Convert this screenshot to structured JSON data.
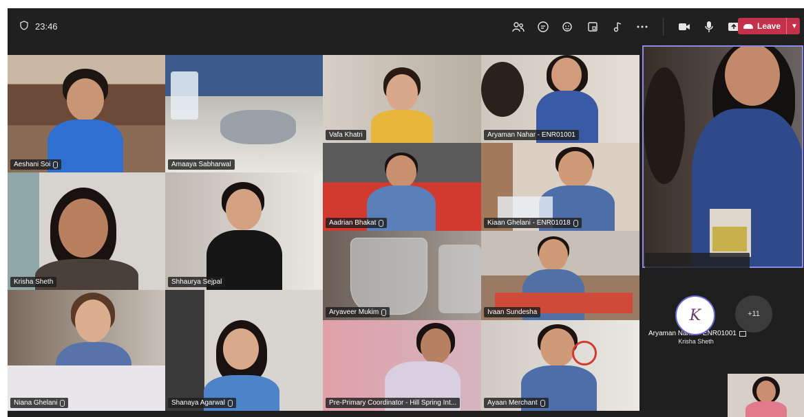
{
  "topbar": {
    "time": "23:46",
    "icons": [
      "shield-icon",
      "people-icon",
      "chat-icon",
      "reactions-icon",
      "rooms-icon",
      "apps-icon",
      "more-icon",
      "camera-icon",
      "mic-icon",
      "share-icon"
    ],
    "leave_label": "Leave"
  },
  "tiles": [
    {
      "name": "Aeshani Soi",
      "muted": true
    },
    {
      "name": "Amaaya Sabharwal",
      "muted": false
    },
    {
      "name": "Vafa Khatri",
      "muted": false
    },
    {
      "name": "Aryaman Nahar - ENR01001",
      "muted": false
    },
    {
      "name": "Krisha Sheth",
      "muted": false
    },
    {
      "name": "Shhaurya Sejpal",
      "muted": false
    },
    {
      "name": "Aadrian Bhakat",
      "muted": true
    },
    {
      "name": "Kiaan Ghelani - ENR01018",
      "muted": true
    },
    {
      "name": "Aryaveer Mukim",
      "muted": true
    },
    {
      "name": "Ivaan Sundesha",
      "muted": false
    },
    {
      "name": "Niana Ghelani",
      "muted": true
    },
    {
      "name": "Shanaya Agarwal",
      "muted": true
    },
    {
      "name": "Pre-Primary Coordinator - Hill Spring Int...",
      "muted": false
    },
    {
      "name": "Ayaan Merchant",
      "muted": true
    }
  ],
  "spotlight": {
    "name": "Aryaman Nahar - ENR01001"
  },
  "roster": {
    "avatar_initial": "K",
    "avatar_name": "Krisha Sheth",
    "more_count": "+11"
  },
  "colors": {
    "leave": "#c4314b",
    "spotlight_border": "#8b8ae6",
    "background": "#1f1f1f"
  }
}
